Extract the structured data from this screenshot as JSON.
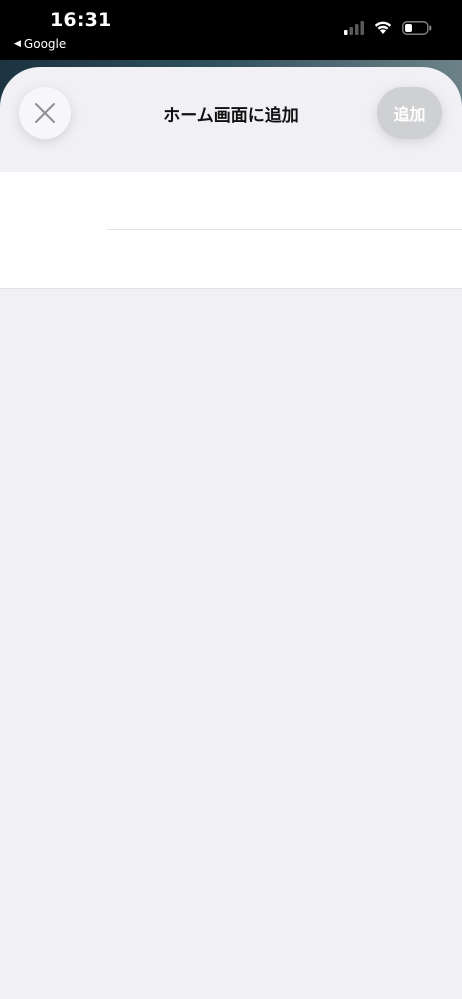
{
  "status_bar": {
    "time": "16:31",
    "back_label": "Google",
    "back_glyph": "◀",
    "icons": [
      "cellular-signal-icon",
      "wifi-icon",
      "battery-icon"
    ]
  },
  "sheet": {
    "title": "ホーム画面に追加",
    "close_icon": "close-icon",
    "add_label": "追加"
  },
  "colors": {
    "sheet_background": "#f1f1f5",
    "add_button_disabled": "#cfd0d2",
    "form_background": "#ffffff"
  }
}
